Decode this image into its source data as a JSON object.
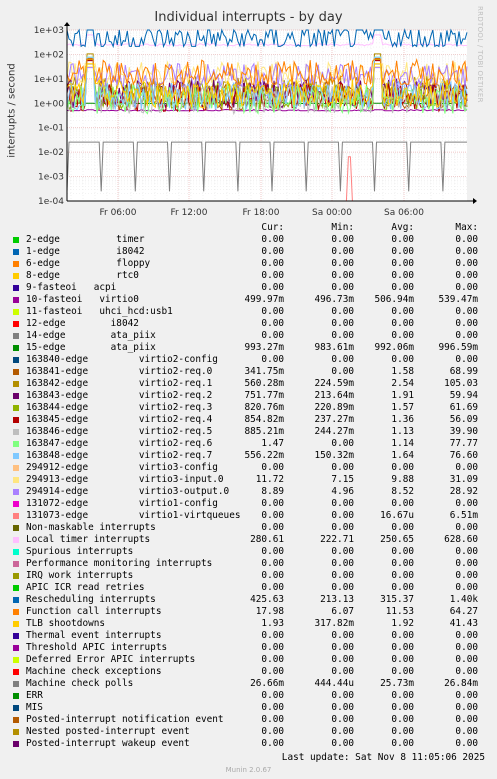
{
  "title": "Individual interrupts - by day",
  "side_label": "RRDTOOL / TOBI OETIKER",
  "footer": {
    "last_update": "Last update: Sat Nov  8 11:05:06 2025",
    "version": "Munin 2.0.67"
  },
  "legend_headers": {
    "cur": "Cur:",
    "min": "Min:",
    "avg": "Avg:",
    "max": "Max:"
  },
  "chart_data": {
    "type": "line",
    "title": "Individual interrupts - by day",
    "ylabel": "interrupts / second",
    "y_scale": "log",
    "ylim": [
      0.0001,
      1000
    ],
    "y_ticks": [
      "1e+03",
      "1e+02",
      "1e+01",
      "1e+00",
      "1e-01",
      "1e-02",
      "1e-03",
      "1e-04"
    ],
    "x_ticks": [
      "Fr 06:00",
      "Fr 12:00",
      "Fr 18:00",
      "Sa 00:00",
      "Sa 06:00"
    ],
    "grid": true,
    "series": [
      {
        "name": "2-edge          timer",
        "color": "#00cc00",
        "cur": "0.00",
        "min": "0.00",
        "avg": "0.00",
        "max": "0.00"
      },
      {
        "name": "1-edge          i8042",
        "color": "#0066b3",
        "cur": "0.00",
        "min": "0.00",
        "avg": "0.00",
        "max": "0.00"
      },
      {
        "name": "6-edge          floppy",
        "color": "#ff8000",
        "cur": "0.00",
        "min": "0.00",
        "avg": "0.00",
        "max": "0.00"
      },
      {
        "name": "8-edge          rtc0",
        "color": "#ffcc00",
        "cur": "0.00",
        "min": "0.00",
        "avg": "0.00",
        "max": "0.00"
      },
      {
        "name": "9-fasteoi   acpi",
        "color": "#330099",
        "cur": "0.00",
        "min": "0.00",
        "avg": "0.00",
        "max": "0.00"
      },
      {
        "name": "10-fasteoi   virtio0",
        "color": "#990099",
        "cur": "499.97m",
        "min": "496.73m",
        "avg": "506.94m",
        "max": "539.47m"
      },
      {
        "name": "11-fasteoi   uhci_hcd:usb1",
        "color": "#ccff00",
        "cur": "0.00",
        "min": "0.00",
        "avg": "0.00",
        "max": "0.00"
      },
      {
        "name": "12-edge        i8042",
        "color": "#ff0000",
        "cur": "0.00",
        "min": "0.00",
        "avg": "0.00",
        "max": "0.00"
      },
      {
        "name": "14-edge        ata_piix",
        "color": "#808080",
        "cur": "0.00",
        "min": "0.00",
        "avg": "0.00",
        "max": "0.00"
      },
      {
        "name": "15-edge        ata_piix",
        "color": "#008f00",
        "cur": "993.27m",
        "min": "983.61m",
        "avg": "992.06m",
        "max": "996.59m"
      },
      {
        "name": "163840-edge         virtio2-config",
        "color": "#00487d",
        "cur": "0.00",
        "min": "0.00",
        "avg": "0.00",
        "max": "0.00"
      },
      {
        "name": "163841-edge         virtio2-req.0",
        "color": "#b35a00",
        "cur": "341.75m",
        "min": "0.00",
        "avg": "1.58",
        "max": "68.99"
      },
      {
        "name": "163842-edge         virtio2-req.1",
        "color": "#b38f00",
        "cur": "560.28m",
        "min": "224.59m",
        "avg": "2.54",
        "max": "105.03"
      },
      {
        "name": "163843-edge         virtio2-req.2",
        "color": "#6b006b",
        "cur": "751.77m",
        "min": "213.64m",
        "avg": "1.91",
        "max": "59.94"
      },
      {
        "name": "163844-edge         virtio2-req.3",
        "color": "#8fb300",
        "cur": "820.76m",
        "min": "220.89m",
        "avg": "1.57",
        "max": "61.69"
      },
      {
        "name": "163845-edge         virtio2-req.4",
        "color": "#b30000",
        "cur": "854.82m",
        "min": "237.27m",
        "avg": "1.36",
        "max": "56.09"
      },
      {
        "name": "163846-edge         virtio2-req.5",
        "color": "#bebebe",
        "cur": "885.21m",
        "min": "244.27m",
        "avg": "1.13",
        "max": "39.90"
      },
      {
        "name": "163847-edge         virtio2-req.6",
        "color": "#80ff80",
        "cur": "1.47",
        "min": "0.00",
        "avg": "1.14",
        "max": "77.77"
      },
      {
        "name": "163848-edge         virtio2-req.7",
        "color": "#80c9ff",
        "cur": "556.22m",
        "min": "150.32m",
        "avg": "1.64",
        "max": "76.60"
      },
      {
        "name": "294912-edge         virtio3-config",
        "color": "#ffc080",
        "cur": "0.00",
        "min": "0.00",
        "avg": "0.00",
        "max": "0.00"
      },
      {
        "name": "294913-edge         virtio3-input.0",
        "color": "#ffe680",
        "cur": "11.72",
        "min": "7.15",
        "avg": "9.88",
        "max": "31.09"
      },
      {
        "name": "294914-edge         virtio3-output.0",
        "color": "#aa80ff",
        "cur": "8.89",
        "min": "4.96",
        "avg": "8.52",
        "max": "28.92"
      },
      {
        "name": "131072-edge         virtio1-config",
        "color": "#ee00cc",
        "cur": "0.00",
        "min": "0.00",
        "avg": "0.00",
        "max": "0.00"
      },
      {
        "name": "131073-edge         virtio1-virtqueues",
        "color": "#ff8080",
        "cur": "0.00",
        "min": "0.00",
        "avg": "16.67u",
        "max": "6.51m"
      },
      {
        "name": "Non-maskable interrupts",
        "color": "#666600",
        "cur": "0.00",
        "min": "0.00",
        "avg": "0.00",
        "max": "0.00"
      },
      {
        "name": "Local timer interrupts",
        "color": "#ffbfff",
        "cur": "280.61",
        "min": "222.71",
        "avg": "250.65",
        "max": "628.60"
      },
      {
        "name": "Spurious interrupts",
        "color": "#00ffcc",
        "cur": "0.00",
        "min": "0.00",
        "avg": "0.00",
        "max": "0.00"
      },
      {
        "name": "Performance monitoring interrupts",
        "color": "#cc6699",
        "cur": "0.00",
        "min": "0.00",
        "avg": "0.00",
        "max": "0.00"
      },
      {
        "name": "IRQ work interrupts",
        "color": "#999900",
        "cur": "0.00",
        "min": "0.00",
        "avg": "0.00",
        "max": "0.00"
      },
      {
        "name": "APIC ICR read retries",
        "color": "#00cc00",
        "cur": "0.00",
        "min": "0.00",
        "avg": "0.00",
        "max": "0.00"
      },
      {
        "name": "Rescheduling interrupts",
        "color": "#0066b3",
        "cur": "425.63",
        "min": "213.13",
        "avg": "315.37",
        "max": "1.40k"
      },
      {
        "name": "Function call interrupts",
        "color": "#ff8000",
        "cur": "17.98",
        "min": "6.07",
        "avg": "11.53",
        "max": "64.27"
      },
      {
        "name": "TLB shootdowns",
        "color": "#ffcc00",
        "cur": "1.93",
        "min": "317.82m",
        "avg": "1.92",
        "max": "41.43"
      },
      {
        "name": "Thermal event interrupts",
        "color": "#330099",
        "cur": "0.00",
        "min": "0.00",
        "avg": "0.00",
        "max": "0.00"
      },
      {
        "name": "Threshold APIC interrupts",
        "color": "#990099",
        "cur": "0.00",
        "min": "0.00",
        "avg": "0.00",
        "max": "0.00"
      },
      {
        "name": "Deferred Error APIC interrupts",
        "color": "#ccff00",
        "cur": "0.00",
        "min": "0.00",
        "avg": "0.00",
        "max": "0.00"
      },
      {
        "name": "Machine check exceptions",
        "color": "#ff0000",
        "cur": "0.00",
        "min": "0.00",
        "avg": "0.00",
        "max": "0.00"
      },
      {
        "name": "Machine check polls",
        "color": "#808080",
        "cur": "26.66m",
        "min": "444.44u",
        "avg": "25.73m",
        "max": "26.84m"
      },
      {
        "name": "ERR",
        "color": "#008f00",
        "cur": "0.00",
        "min": "0.00",
        "avg": "0.00",
        "max": "0.00"
      },
      {
        "name": "MIS",
        "color": "#00487d",
        "cur": "0.00",
        "min": "0.00",
        "avg": "0.00",
        "max": "0.00"
      },
      {
        "name": "Posted-interrupt notification event",
        "color": "#b35a00",
        "cur": "0.00",
        "min": "0.00",
        "avg": "0.00",
        "max": "0.00"
      },
      {
        "name": "Nested posted-interrupt event",
        "color": "#b38f00",
        "cur": "0.00",
        "min": "0.00",
        "avg": "0.00",
        "max": "0.00"
      },
      {
        "name": "Posted-interrupt wakeup event",
        "color": "#6b006b",
        "cur": "0.00",
        "min": "0.00",
        "avg": "0.00",
        "max": "0.00"
      }
    ]
  }
}
